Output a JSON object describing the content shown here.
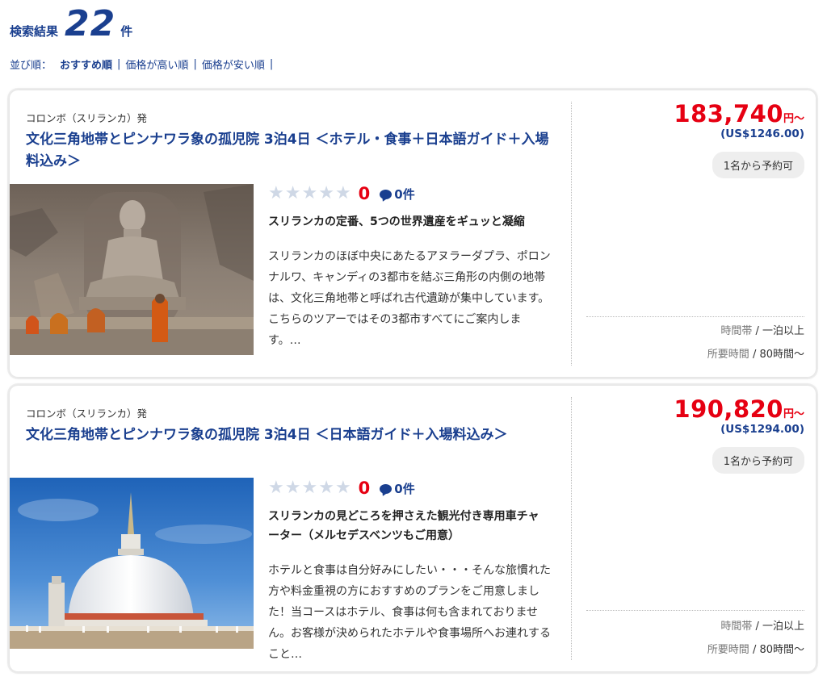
{
  "header": {
    "label": "検索結果",
    "count": "22",
    "unit": "件"
  },
  "sort": {
    "label": "並び順：",
    "options": [
      "おすすめ順",
      "価格が高い順",
      "価格が安い順"
    ],
    "separator": "|"
  },
  "tours": [
    {
      "origin": "コロンボ（スリランカ）発",
      "title": "文化三角地帯とピンナワラ象の孤児院 3泊4日 ＜ホテル・食事＋日本語ガイド＋入場料込み＞",
      "image": "buddha-statue-photo",
      "stars": "★★★★★",
      "rating": "0",
      "reviews": "0件",
      "headline": "スリランカの定番、5つの世界遺産をギュッと凝縮",
      "description": "スリランカのほぼ中央にあたるアヌラーダプラ、ポロンナルワ、キャンディの3都市を結ぶ三角形の内側の地帯は、文化三角地帯と呼ばれ古代遺跡が集中しています。こちらのツアーではその3都市すべてにご案内します。…",
      "price": "183,740",
      "price_unit": "円〜",
      "usd": "(US$1246.00)",
      "badge": "1名から予約可",
      "time_label": "時間帯",
      "time_value": " / 一泊以上",
      "duration_label": "所要時間",
      "duration_value": " / 80時間〜"
    },
    {
      "origin": "コロンボ（スリランカ）発",
      "title": "文化三角地帯とピンナワラ象の孤児院 3泊4日 ＜日本語ガイド＋入場料込み＞",
      "image": "stupa-photo",
      "stars": "★★★★★",
      "rating": "0",
      "reviews": "0件",
      "headline": "スリランカの見どころを押さえた観光付き専用車チャーター（メルセデスベンツもご用意）",
      "description": "ホテルと食事は自分好みにしたい・・・そんな旅慣れた方や料金重視の方におすすめのプランをご用意しました！当コースはホテル、食事は何も含まれておりません。お客様が決められたホテルや食事場所へお連れすること…",
      "price": "190,820",
      "price_unit": "円〜",
      "usd": "(US$1294.00)",
      "badge": "1名から予約可",
      "time_label": "時間帯",
      "time_value": " / 一泊以上",
      "duration_label": "所要時間",
      "duration_value": " / 80時間〜"
    }
  ],
  "colors": {
    "accent": "#1a3f8f",
    "price": "#e60012",
    "star_empty": "#cfd8e6"
  }
}
